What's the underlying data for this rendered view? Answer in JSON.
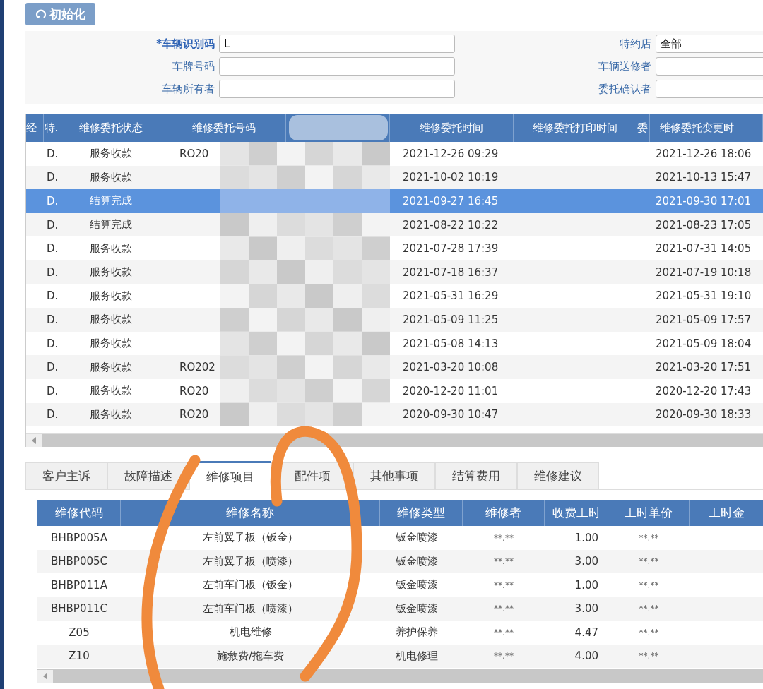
{
  "toolbar": {
    "reset_button": "初始化"
  },
  "search_form": {
    "left": [
      {
        "label": "*车辆识别码",
        "required": true,
        "value": "L"
      },
      {
        "label": "车牌号码",
        "required": false
      },
      {
        "label": "车辆所有者",
        "required": false
      }
    ],
    "right": [
      {
        "label": "特约店",
        "value": "全部"
      },
      {
        "label": "车辆送修者"
      },
      {
        "label": "委托确认者"
      }
    ]
  },
  "orders_table": {
    "columns": [
      "经",
      "特.",
      "维修委托状态",
      "维修委托号码",
      "",
      "维修委托时间",
      "维修委托打印时间",
      "委",
      "维修委托变更时"
    ],
    "rows": [
      {
        "selected": false,
        "cells": [
          "",
          "D.",
          "服务收款",
          "RO20",
          "",
          "2021-12-26 09:29",
          "",
          "",
          "2021-12-26 18:06"
        ]
      },
      {
        "selected": false,
        "cells": [
          "",
          "D.",
          "服务收款",
          "",
          "",
          "2021-10-02 10:19",
          "",
          "",
          "2021-10-13 15:47"
        ]
      },
      {
        "selected": true,
        "cells": [
          "",
          "D.",
          "结算完成",
          "",
          "",
          "2021-09-27 16:45",
          "",
          "",
          "2021-09-30 17:01"
        ]
      },
      {
        "selected": false,
        "cells": [
          "",
          "D.",
          "结算完成",
          "",
          "",
          "2021-08-22 10:22",
          "",
          "",
          "2021-08-23 17:05"
        ]
      },
      {
        "selected": false,
        "cells": [
          "",
          "D.",
          "服务收款",
          "",
          "",
          "2021-07-28 17:39",
          "",
          "",
          "2021-07-31 14:05"
        ]
      },
      {
        "selected": false,
        "cells": [
          "",
          "D.",
          "服务收款",
          "",
          "",
          "2021-07-18 16:37",
          "",
          "",
          "2021-07-19 10:18"
        ]
      },
      {
        "selected": false,
        "cells": [
          "",
          "D.",
          "服务收款",
          "",
          "",
          "2021-05-31 16:29",
          "",
          "",
          "2021-05-31 19:10"
        ]
      },
      {
        "selected": false,
        "cells": [
          "",
          "D.",
          "服务收款",
          "",
          "",
          "2021-05-09 11:25",
          "",
          "",
          "2021-05-09 17:57"
        ]
      },
      {
        "selected": false,
        "cells": [
          "",
          "D.",
          "服务收款",
          "",
          "",
          "2021-05-08 14:13",
          "",
          "",
          "2021-05-09 18:04"
        ]
      },
      {
        "selected": false,
        "cells": [
          "",
          "D.",
          "服务收款",
          "RO202",
          "",
          "2021-03-20 10:08",
          "",
          "",
          "2021-03-20 17:51"
        ]
      },
      {
        "selected": false,
        "cells": [
          "",
          "D.",
          "服务收款",
          "RO20",
          "",
          "2020-12-20 11:01",
          "",
          "",
          "2020-12-20 17:43"
        ]
      },
      {
        "selected": false,
        "cells": [
          "",
          "D.",
          "服务收款",
          "RO20",
          "",
          "2020-09-30 10:47",
          "",
          "",
          "2020-09-30 18:33"
        ]
      }
    ]
  },
  "detail_tabs": [
    {
      "label": "客户主诉",
      "selected": false
    },
    {
      "label": "故障描述",
      "selected": false
    },
    {
      "label": "维修项目",
      "selected": true
    },
    {
      "label": "配件项",
      "selected": false
    },
    {
      "label": "其他事项",
      "selected": false
    },
    {
      "label": "结算费用",
      "selected": false
    },
    {
      "label": "维修建议",
      "selected": false
    }
  ],
  "items_table": {
    "columns": [
      "维修代码",
      "维修名称",
      "维修类型",
      "维修者",
      "收费工时",
      "工时单价",
      "工时金"
    ],
    "rows": [
      [
        "BHBP005A",
        "左前翼子板（钣金）",
        "钣金喷漆",
        "**.**",
        "1.00",
        "**.**",
        ""
      ],
      [
        "BHBP005C",
        "左前翼子板（喷漆）",
        "钣金喷漆",
        "**.**",
        "3.00",
        "**.**",
        ""
      ],
      [
        "BHBP011A",
        "左前车门板（钣金）",
        "钣金喷漆",
        "**.**",
        "1.00",
        "**.**",
        ""
      ],
      [
        "BHBP011C",
        "左前车门板（喷漆）",
        "钣金喷漆",
        "**.**",
        "3.00",
        "**.**",
        ""
      ],
      [
        "Z05",
        "机电维修",
        "养护保养",
        "**.**",
        "4.47",
        "**.**",
        ""
      ],
      [
        "Z10",
        "施救费/拖车费",
        "机电修理",
        "**.**",
        "4.00",
        "**.**",
        ""
      ]
    ]
  }
}
